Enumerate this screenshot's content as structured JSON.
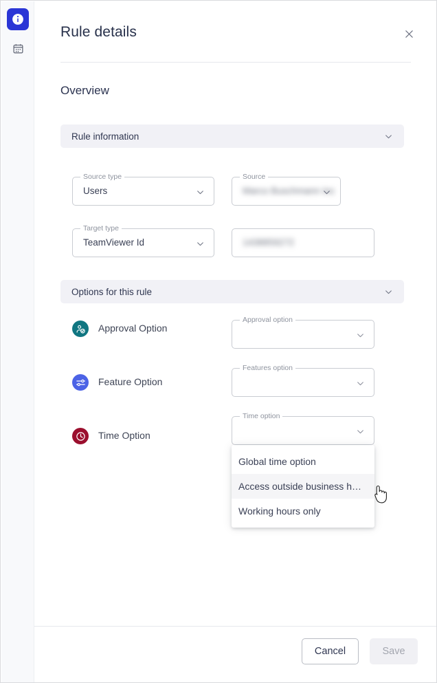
{
  "rail": {
    "items": [
      {
        "name": "info",
        "icon": "info-icon",
        "active": true
      },
      {
        "name": "calendar",
        "icon": "calendar-icon",
        "active": false
      }
    ],
    "active_color": "#2b36d6"
  },
  "dialog": {
    "title": "Rule details",
    "close_label": "×",
    "section_title": "Overview"
  },
  "sections": {
    "rule_information": {
      "label": "Rule information",
      "expanded": true
    },
    "options_for_this_rule": {
      "label": "Options for this rule",
      "expanded": true
    }
  },
  "fields": {
    "source_type": {
      "label": "Source type",
      "value": "Users"
    },
    "source": {
      "label": "Source",
      "value": "Marco Buschmann Inc",
      "redacted": true
    },
    "target_type": {
      "label": "Target type",
      "value": "TeamViewer Id"
    },
    "target_id": {
      "label": "",
      "value": "1438859272",
      "redacted": true
    },
    "approval_option": {
      "label": "Approval option",
      "value": ""
    },
    "features_option": {
      "label": "Features option",
      "value": ""
    },
    "time_option": {
      "label": "Time option",
      "value": ""
    }
  },
  "options": [
    {
      "label": "Approval Option",
      "icon": "approval-person-check-icon",
      "color": "#107681"
    },
    {
      "label": "Feature Option",
      "icon": "tune-sliders-icon",
      "color": "#4c63e6"
    },
    {
      "label": "Time Option",
      "icon": "clock-icon",
      "color": "#9b0f2e"
    }
  ],
  "time_option_menu": {
    "open": true,
    "items": [
      {
        "label": "Global time option",
        "hovered": false
      },
      {
        "label": "Access outside business h…",
        "hovered": true
      },
      {
        "label": "Working hours only",
        "hovered": false
      }
    ]
  },
  "footer": {
    "cancel_label": "Cancel",
    "save_label": "Save",
    "save_disabled": true
  }
}
